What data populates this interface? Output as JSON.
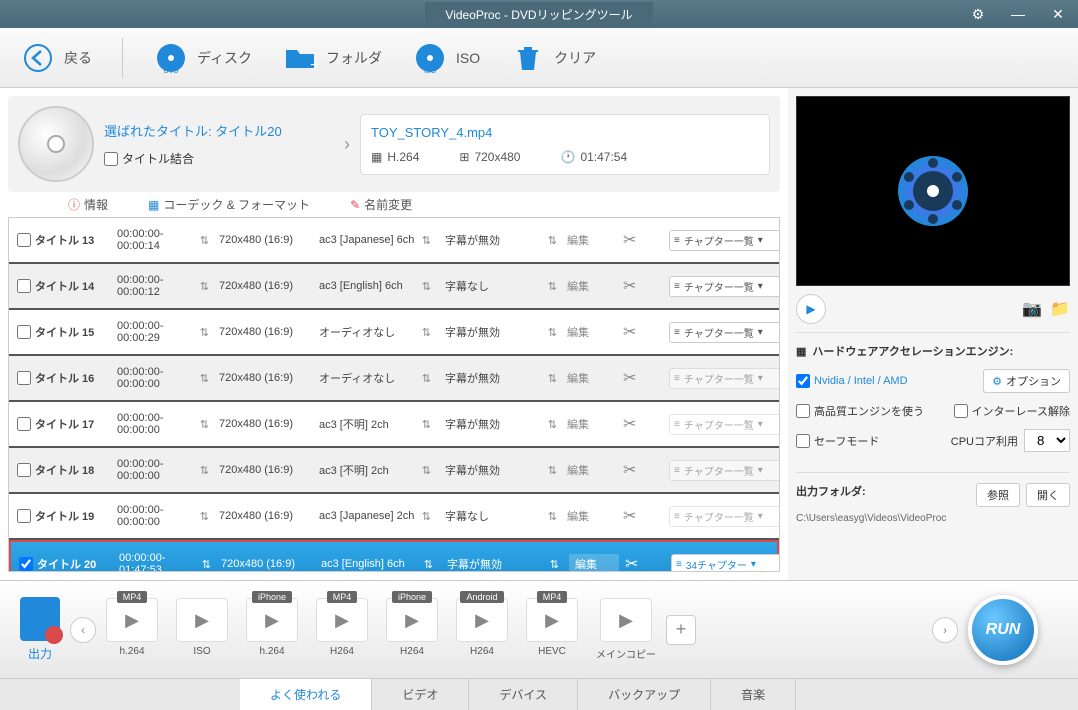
{
  "titlebar": {
    "title": "VideoProc - DVDリッピングツール"
  },
  "toolbar": {
    "back": "戻る",
    "disc": "ディスク",
    "folder": "フォルダ",
    "iso": "ISO",
    "clear": "クリア"
  },
  "info": {
    "selected_title": "選ばれたタイトル: タイトル20",
    "merge_label": "タイトル結合",
    "filename": "TOY_STORY_4.mp4",
    "codec": "H.264",
    "resolution": "720x480",
    "duration": "01:47:54"
  },
  "info_tabs": {
    "info": "情報",
    "codec": "コーデック & フォーマット",
    "rename": "名前変更"
  },
  "titles": [
    {
      "name": "タイトル 13",
      "time": "00:00:00-00:00:14",
      "res": "720x480 (16:9)",
      "audio": "ac3 [Japanese] 6ch",
      "sub": "字幕が無効",
      "edit": "編集",
      "chapter": "チャプター一覧",
      "selected": false,
      "ch_disabled": false
    },
    {
      "name": "タイトル 14",
      "time": "00:00:00-00:00:12",
      "res": "720x480 (16:9)",
      "audio": "ac3 [English] 6ch",
      "sub": "字幕なし",
      "edit": "編集",
      "chapter": "チャプター一覧",
      "selected": false,
      "ch_disabled": false
    },
    {
      "name": "タイトル 15",
      "time": "00:00:00-00:00:29",
      "res": "720x480 (16:9)",
      "audio": "オーディオなし",
      "sub": "字幕が無効",
      "edit": "編集",
      "chapter": "チャプター一覧",
      "selected": false,
      "ch_disabled": false
    },
    {
      "name": "タイトル 16",
      "time": "00:00:00-00:00:00",
      "res": "720x480 (16:9)",
      "audio": "オーディオなし",
      "sub": "字幕が無効",
      "edit": "編集",
      "chapter": "チャプター一覧",
      "selected": false,
      "ch_disabled": true
    },
    {
      "name": "タイトル 17",
      "time": "00:00:00-00:00:00",
      "res": "720x480 (16:9)",
      "audio": "ac3 [不明] 2ch",
      "sub": "字幕が無効",
      "edit": "編集",
      "chapter": "チャプター一覧",
      "selected": false,
      "ch_disabled": true
    },
    {
      "name": "タイトル 18",
      "time": "00:00:00-00:00:00",
      "res": "720x480 (16:9)",
      "audio": "ac3 [不明] 2ch",
      "sub": "字幕が無効",
      "edit": "編集",
      "chapter": "チャプター一覧",
      "selected": false,
      "ch_disabled": true
    },
    {
      "name": "タイトル 19",
      "time": "00:00:00-00:00:00",
      "res": "720x480 (16:9)",
      "audio": "ac3 [Japanese] 2ch",
      "sub": "字幕なし",
      "edit": "編集",
      "chapter": "チャプター一覧",
      "selected": false,
      "ch_disabled": true
    },
    {
      "name": "タイトル 20",
      "time": "00:00:00-01:47:53",
      "res": "720x480 (16:9)",
      "audio": "ac3 [English] 6ch",
      "sub": "字幕が無効",
      "edit": "編集",
      "chapter": "34チャプター",
      "selected": true,
      "ch_disabled": false
    }
  ],
  "hardware": {
    "title": "ハードウェアアクセレーションエンジン:",
    "gpu_label": "Nvidia / Intel / AMD",
    "option_btn": "オプション",
    "hq_label": "高品質エンジンを使う",
    "deinterlace_label": "インターレース解除",
    "safe_mode": "セーフモード",
    "cpu_label": "CPUコア利用",
    "cpu_value": "8"
  },
  "output": {
    "label": "出力フォルダ:",
    "browse": "参照",
    "open": "開く",
    "path": "C:\\Users\\easyg\\Videos\\VideoProc"
  },
  "formats": {
    "output_label": "出力",
    "items": [
      {
        "badge": "MP4",
        "label": "h.264"
      },
      {
        "badge": "",
        "label": "ISO"
      },
      {
        "badge": "iPhone",
        "label": "h.264"
      },
      {
        "badge": "MP4",
        "label": "H264"
      },
      {
        "badge": "iPhone",
        "label": "H264"
      },
      {
        "badge": "Android",
        "label": "H264"
      },
      {
        "badge": "MP4",
        "label": "HEVC"
      },
      {
        "badge": "",
        "label": "メインコピー"
      }
    ]
  },
  "format_tabs": {
    "common": "よく使われる",
    "video": "ビデオ",
    "device": "デバイス",
    "backup": "バックアップ",
    "music": "音楽"
  },
  "run_label": "RUN"
}
